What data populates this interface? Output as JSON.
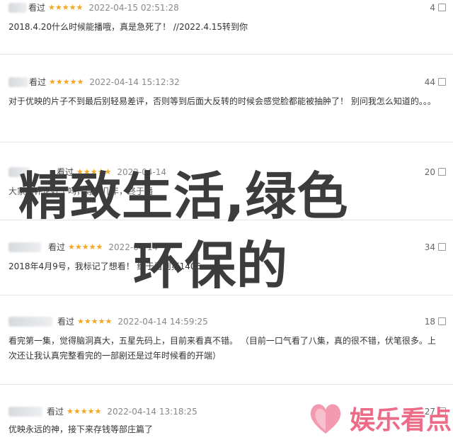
{
  "reviews": [
    {
      "status": "看过",
      "stars": "★★★★★",
      "time": "2022-04-15 02:51:28",
      "votes": "4",
      "content": "2018.4.20什么时候能播哦，真是急死了！ //2022.4.15转到你"
    },
    {
      "status": "看过",
      "stars": "★★★★★",
      "time": "2022-04-14 15:12:32",
      "votes": "44",
      "content": "对于优映的片子不到最后别轻易差评，否则等到后面大反转的时候会感觉脸都能被抽肿了！ 别问我怎么知道的。。。"
    },
    {
      "status": "看过",
      "stars": "★★★★★",
      "time": "2022-04-14",
      "votes": "20",
      "content": "大家的评论好了吗，等了几年，终于播"
    },
    {
      "status": "看过",
      "stars": "★★★★★",
      "time": "2022-04-14",
      "votes": "34",
      "content": "2018年4月9号，我标记了想看！ 终于看到第1406"
    },
    {
      "status": "看过",
      "stars": "★★★★★",
      "time": "2022-04-14 14:59:25",
      "votes": "18",
      "content": "看完第一集，觉得脑洞真大，五星先码上，目前来看真不错。 （目前一口气看了八集，真的很不错，伏笔很多。上次还让我认真完整看完的一部剧还是过年时候看的开端）"
    },
    {
      "status": "看过",
      "stars": "★★★★★",
      "time": "2022-04-14 13:18:25",
      "votes": "27",
      "content": "优映永远的神，接下来存钱等部庄篇了"
    }
  ],
  "overlay": {
    "line1": "精致生活,绿色",
    "line2": "环保的"
  },
  "watermark": {
    "text": "娱乐看点"
  },
  "colors": {
    "stars": "#f5a623",
    "overlay_text": "#3c3c3c",
    "watermark": "#ee6b88",
    "divider": "#e6e6e6"
  }
}
